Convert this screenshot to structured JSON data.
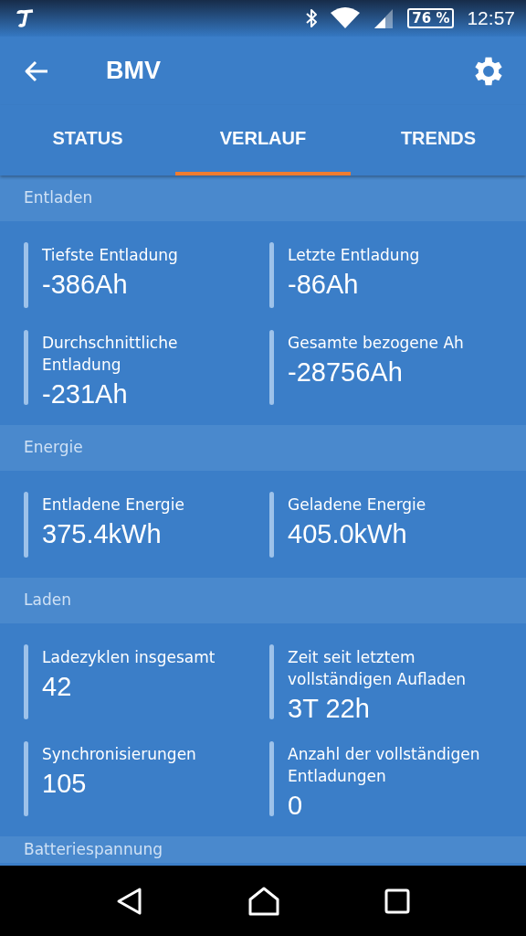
{
  "status_bar": {
    "battery": "76 %",
    "time": "12:57"
  },
  "app_bar": {
    "title": "BMV"
  },
  "tabs": [
    {
      "label": "STATUS",
      "selected": false
    },
    {
      "label": "VERLAUF",
      "selected": true
    },
    {
      "label": "TRENDS",
      "selected": false
    }
  ],
  "sections": [
    {
      "title": "Entladen",
      "items": [
        {
          "label": "Tiefste Entladung",
          "value": "-386Ah"
        },
        {
          "label": "Letzte Entladung",
          "value": "-86Ah"
        },
        {
          "label": "Durchschnittliche Entladung",
          "value": "-231Ah"
        },
        {
          "label": "Gesamte bezogene Ah",
          "value": "-28756Ah"
        }
      ]
    },
    {
      "title": "Energie",
      "items": [
        {
          "label": "Entladene Energie",
          "value": "375.4kWh"
        },
        {
          "label": "Geladene Energie",
          "value": "405.0kWh"
        }
      ]
    },
    {
      "title": "Laden",
      "items": [
        {
          "label": "Ladezyklen insgesamt",
          "value": "42"
        },
        {
          "label": "Zeit seit letztem vollständigen Aufladen",
          "value": "3T 22h"
        },
        {
          "label": "Synchronisierungen",
          "value": "105"
        },
        {
          "label": "Anzahl der vollständigen Entladungen",
          "value": "0"
        }
      ]
    },
    {
      "title": "Batteriespannung"
    }
  ]
}
